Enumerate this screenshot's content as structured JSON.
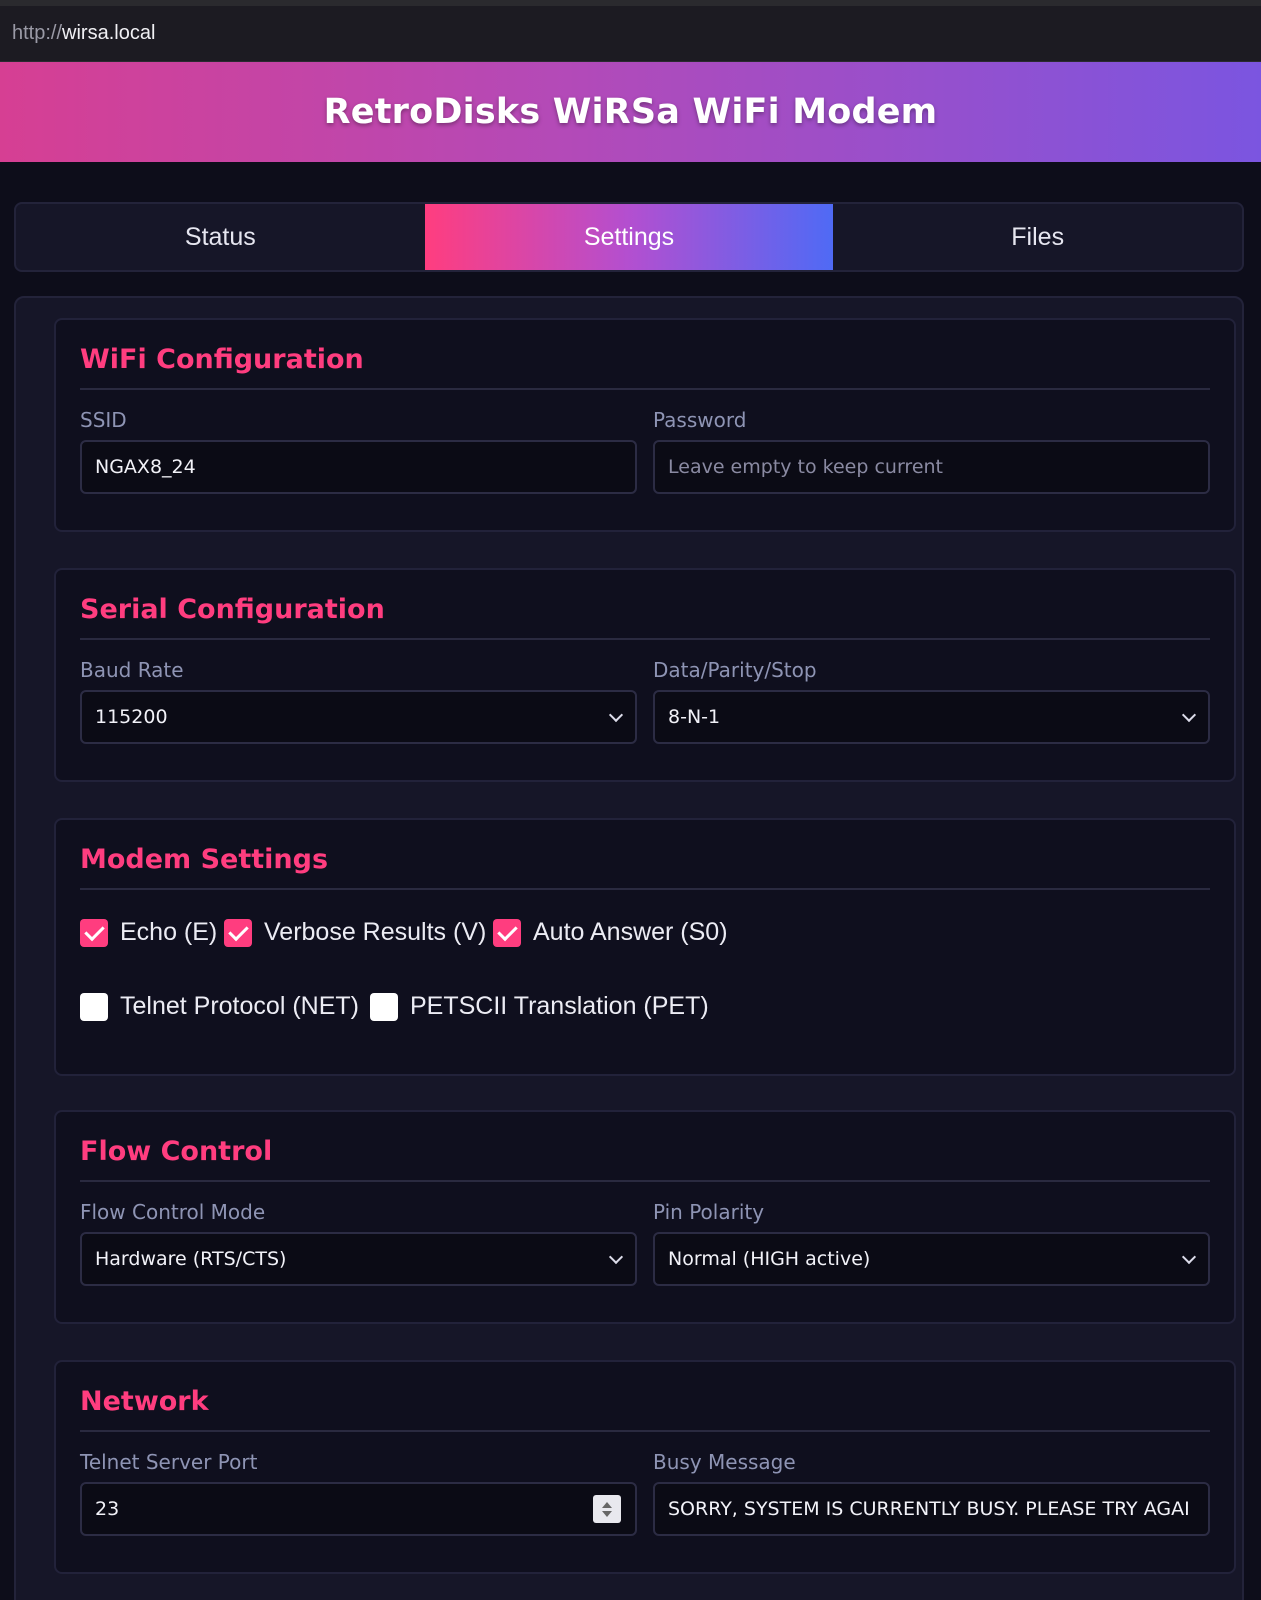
{
  "browser": {
    "url_scheme": "http://",
    "url_host": "wirsa.local"
  },
  "header": {
    "title": "RetroDisks WiRSa WiFi Modem"
  },
  "tabs": [
    {
      "label": "Status",
      "active": false
    },
    {
      "label": "Settings",
      "active": true
    },
    {
      "label": "Files",
      "active": false
    }
  ],
  "wifi": {
    "title": "WiFi Configuration",
    "ssid_label": "SSID",
    "ssid_value": "NGAX8_24",
    "password_label": "Password",
    "password_placeholder": "Leave empty to keep current"
  },
  "serial": {
    "title": "Serial Configuration",
    "baud_label": "Baud Rate",
    "baud_value": "115200",
    "format_label": "Data/Parity/Stop",
    "format_value": "8-N-1"
  },
  "modem": {
    "title": "Modem Settings",
    "options": [
      {
        "label": "Echo (E)",
        "checked": true
      },
      {
        "label": "Verbose Results (V)",
        "checked": true
      },
      {
        "label": "Auto Answer (S0)",
        "checked": true
      },
      {
        "label": "Telnet Protocol (NET)",
        "checked": false
      },
      {
        "label": "PETSCII Translation (PET)",
        "checked": false
      }
    ]
  },
  "flow": {
    "title": "Flow Control",
    "mode_label": "Flow Control Mode",
    "mode_value": "Hardware (RTS/CTS)",
    "polarity_label": "Pin Polarity",
    "polarity_value": "Normal (HIGH active)"
  },
  "network": {
    "title": "Network",
    "port_label": "Telnet Server Port",
    "port_value": "23",
    "busy_label": "Busy Message",
    "busy_value": "SORRY, SYSTEM IS CURRENTLY BUSY. PLEASE TRY AGAI"
  },
  "colors": {
    "accent": "#ff3d7f",
    "background": "#0d0d1a",
    "header_gradient_start": "#d63f93",
    "header_gradient_end": "#7b55e0"
  }
}
